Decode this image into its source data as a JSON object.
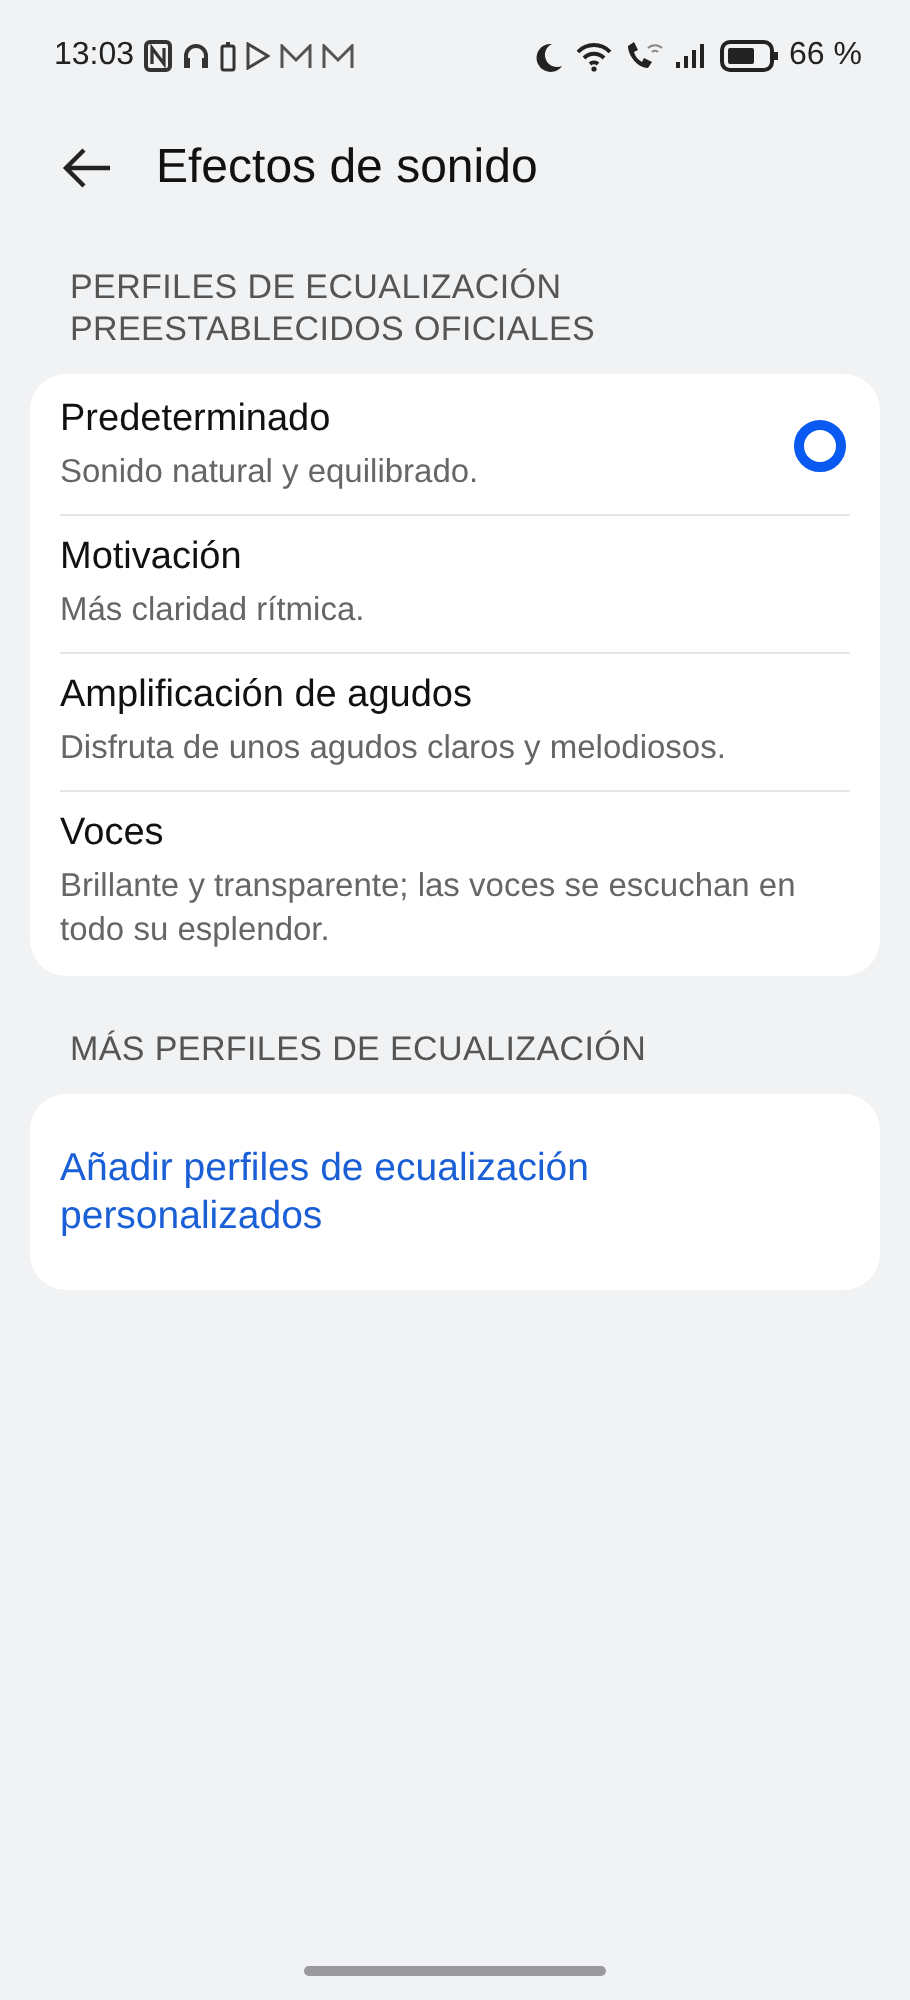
{
  "status_bar": {
    "time": "13:03",
    "battery_text": "66 %"
  },
  "header": {
    "title": "Efectos de sonido"
  },
  "sections": [
    {
      "label": "PERFILES DE ECUALIZACIÓN PREESTABLECIDOS OFICIALES",
      "items": [
        {
          "kind": "radio",
          "title": "Predeterminado",
          "subtitle": "Sonido natural y equilibrado.",
          "selected": true
        },
        {
          "kind": "radio",
          "title": "Motivación",
          "subtitle": "Más claridad rítmica.",
          "selected": false
        },
        {
          "kind": "radio",
          "title": "Amplificación de agudos",
          "subtitle": "Disfruta de unos agudos claros y melodiosos.",
          "selected": false
        },
        {
          "kind": "radio",
          "title": "Voces",
          "subtitle": "Brillante y transparente; las voces se escuchan en todo su esplendor.",
          "selected": false
        }
      ]
    },
    {
      "label": "MÁS PERFILES DE ECUALIZACIÓN",
      "items": [
        {
          "kind": "link",
          "title": "Añadir perfiles de ecualización personalizados"
        }
      ]
    }
  ]
}
